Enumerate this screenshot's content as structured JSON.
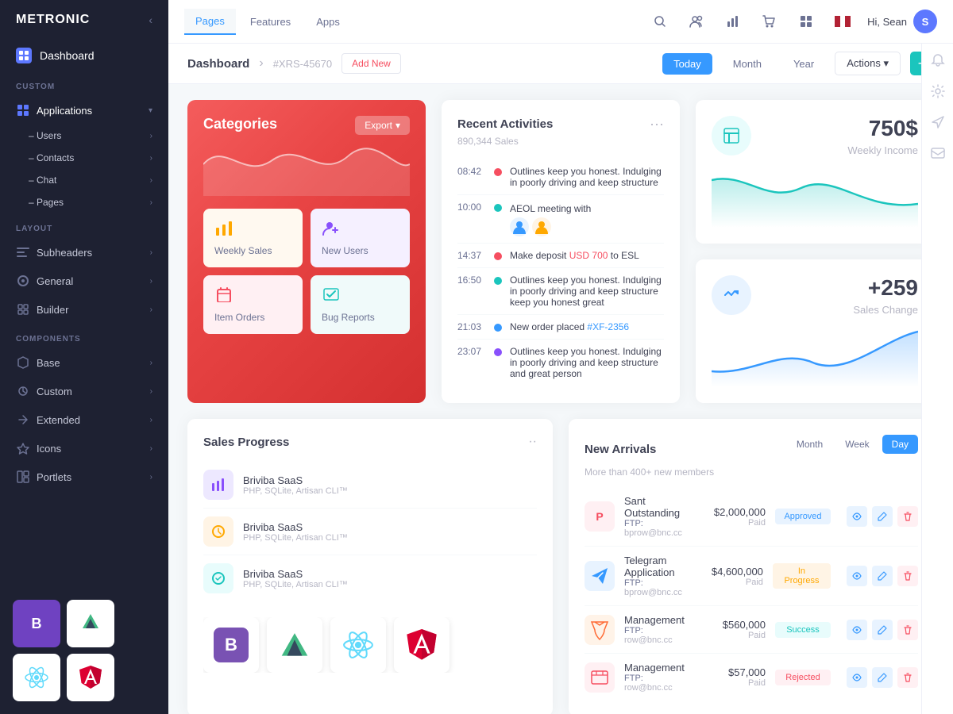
{
  "app": {
    "logo": "METRONIC",
    "collapse_icon": "‹"
  },
  "sidebar": {
    "dashboard_label": "Dashboard",
    "sections": [
      {
        "label": "CUSTOM",
        "items": [
          {
            "id": "applications",
            "label": "Applications",
            "has_arrow": true,
            "expanded": true,
            "sub_items": [
              {
                "label": "Users",
                "has_arrow": true
              },
              {
                "label": "Contacts",
                "has_arrow": true
              },
              {
                "label": "Chat",
                "has_arrow": true
              },
              {
                "label": "Pages",
                "has_arrow": true
              }
            ]
          }
        ]
      },
      {
        "label": "LAYOUT",
        "items": [
          {
            "id": "subheaders",
            "label": "Subheaders",
            "has_arrow": true
          },
          {
            "id": "general",
            "label": "General",
            "has_arrow": true
          },
          {
            "id": "builder",
            "label": "Builder",
            "has_arrow": true
          }
        ]
      },
      {
        "label": "COMPONENTS",
        "items": [
          {
            "id": "base",
            "label": "Base",
            "has_arrow": true
          },
          {
            "id": "custom",
            "label": "Custom",
            "has_arrow": true
          },
          {
            "id": "extended",
            "label": "Extended",
            "has_arrow": true
          },
          {
            "id": "icons",
            "label": "Icons",
            "has_arrow": true
          },
          {
            "id": "portlets",
            "label": "Portlets",
            "has_arrow": true
          }
        ]
      }
    ],
    "frameworks": [
      "B",
      "V",
      "⚛",
      "A"
    ]
  },
  "topnav": {
    "tabs": [
      "Pages",
      "Features",
      "Apps"
    ],
    "active_tab": "Pages",
    "user_name": "Hi, Sean",
    "user_initial": "S"
  },
  "subheader": {
    "title": "Dashboard",
    "id": "#XRS-45670",
    "add_new": "Add New",
    "date_buttons": [
      "Today",
      "Month",
      "Year"
    ],
    "active_date": "Today",
    "actions": "Actions"
  },
  "categories": {
    "title": "Categories",
    "export_label": "Export",
    "items": [
      {
        "label": "Weekly Sales",
        "color": "yellow",
        "icon": "📊"
      },
      {
        "label": "New Users",
        "color": "purple",
        "icon": "👤"
      },
      {
        "label": "Item Orders",
        "color": "pink",
        "icon": "🔸"
      },
      {
        "label": "Bug Reports",
        "color": "teal",
        "icon": "✉️"
      }
    ]
  },
  "recent_activities": {
    "title": "Recent Activities",
    "subtitle": "890,344 Sales",
    "items": [
      {
        "time": "08:42",
        "dot": "orange",
        "text": "Outlines keep you honest. Indulging in poorly driving and keep structure"
      },
      {
        "time": "10:00",
        "dot": "teal",
        "text": "AEOL meeting with",
        "has_avatars": true
      },
      {
        "time": "14:37",
        "dot": "orange",
        "text": "Make deposit ",
        "highlight": "USD 700",
        "text2": " to ESL"
      },
      {
        "time": "16:50",
        "dot": "teal",
        "text": "Outlines keep you honest. Indulging in poorly driving and keep structure keep you honest great"
      },
      {
        "time": "21:03",
        "dot": "blue",
        "text": "New order placed ",
        "highlight": "#XF-2356",
        "highlight_class": "blue"
      },
      {
        "time": "23:07",
        "dot": "purple",
        "text": "Outlines keep you honest. Indulging in poorly driving and keep structure and great person"
      }
    ]
  },
  "stats": [
    {
      "value": "750$",
      "label": "Weekly Income",
      "icon_class": "stats-icon-teal",
      "icon": "🛒",
      "chart_color": "#1bc5bd"
    },
    {
      "value": "+259",
      "label": "Sales Change",
      "icon_class": "stats-icon-blue",
      "icon": "🛒",
      "chart_color": "#3699ff"
    }
  ],
  "sales_progress": {
    "title": "Sales Progress",
    "items": [
      {
        "name": "Briviba SaaS",
        "sub": "PHP, SQLite, Artisan CLI™",
        "bg": "#ede8ff",
        "color": "#8950fc"
      },
      {
        "name": "Briviba SaaS",
        "sub": "PHP, SQLite, Artisan CLI™",
        "bg": "#fff4e5",
        "color": "#ffa800"
      },
      {
        "name": "Briviba SaaS",
        "sub": "PHP, SQLite, Artisan CLI™",
        "bg": "#e8fcfc",
        "color": "#1bc5bd"
      }
    ]
  },
  "new_arrivals": {
    "title": "New Arrivals",
    "subtitle": "More than 400+ new members",
    "tabs": [
      "Month",
      "Week",
      "Day"
    ],
    "active_tab": "Day",
    "rows": [
      {
        "name": "Sant Outstanding",
        "ftp_label": "FTP:",
        "ftp": "bprow@bnc.cc",
        "price": "$2,000,000",
        "paid": "Paid",
        "badge": "Approved",
        "badge_class": "badge-approved",
        "icon_bg": "#fff0f3",
        "icon_color": "#f64e60",
        "icon": "P"
      },
      {
        "name": "Telegram Application",
        "ftp_label": "FTP:",
        "ftp": "bprow@bnc.cc",
        "price": "$4,600,000",
        "paid": "Paid",
        "badge": "In Progress",
        "badge_class": "badge-progress",
        "icon_bg": "#e8f3ff",
        "icon_color": "#3699ff",
        "icon": "✈"
      },
      {
        "name": "Management",
        "ftp_label": "FTP:",
        "ftp": "row@bnc.cc",
        "price": "$560,000",
        "paid": "Paid",
        "badge": "Success",
        "badge_class": "badge-success",
        "icon_bg": "#fff3e8",
        "icon_color": "#ff6b35",
        "icon": "L"
      },
      {
        "name": "Management",
        "ftp_label": "FTP:",
        "ftp": "row@bnc.cc",
        "price": "$57,000",
        "paid": "Paid",
        "badge": "Rejected",
        "badge_class": "badge-rejected",
        "icon_bg": "#fff0f3",
        "icon_color": "#f64e60",
        "icon": "M"
      }
    ]
  }
}
